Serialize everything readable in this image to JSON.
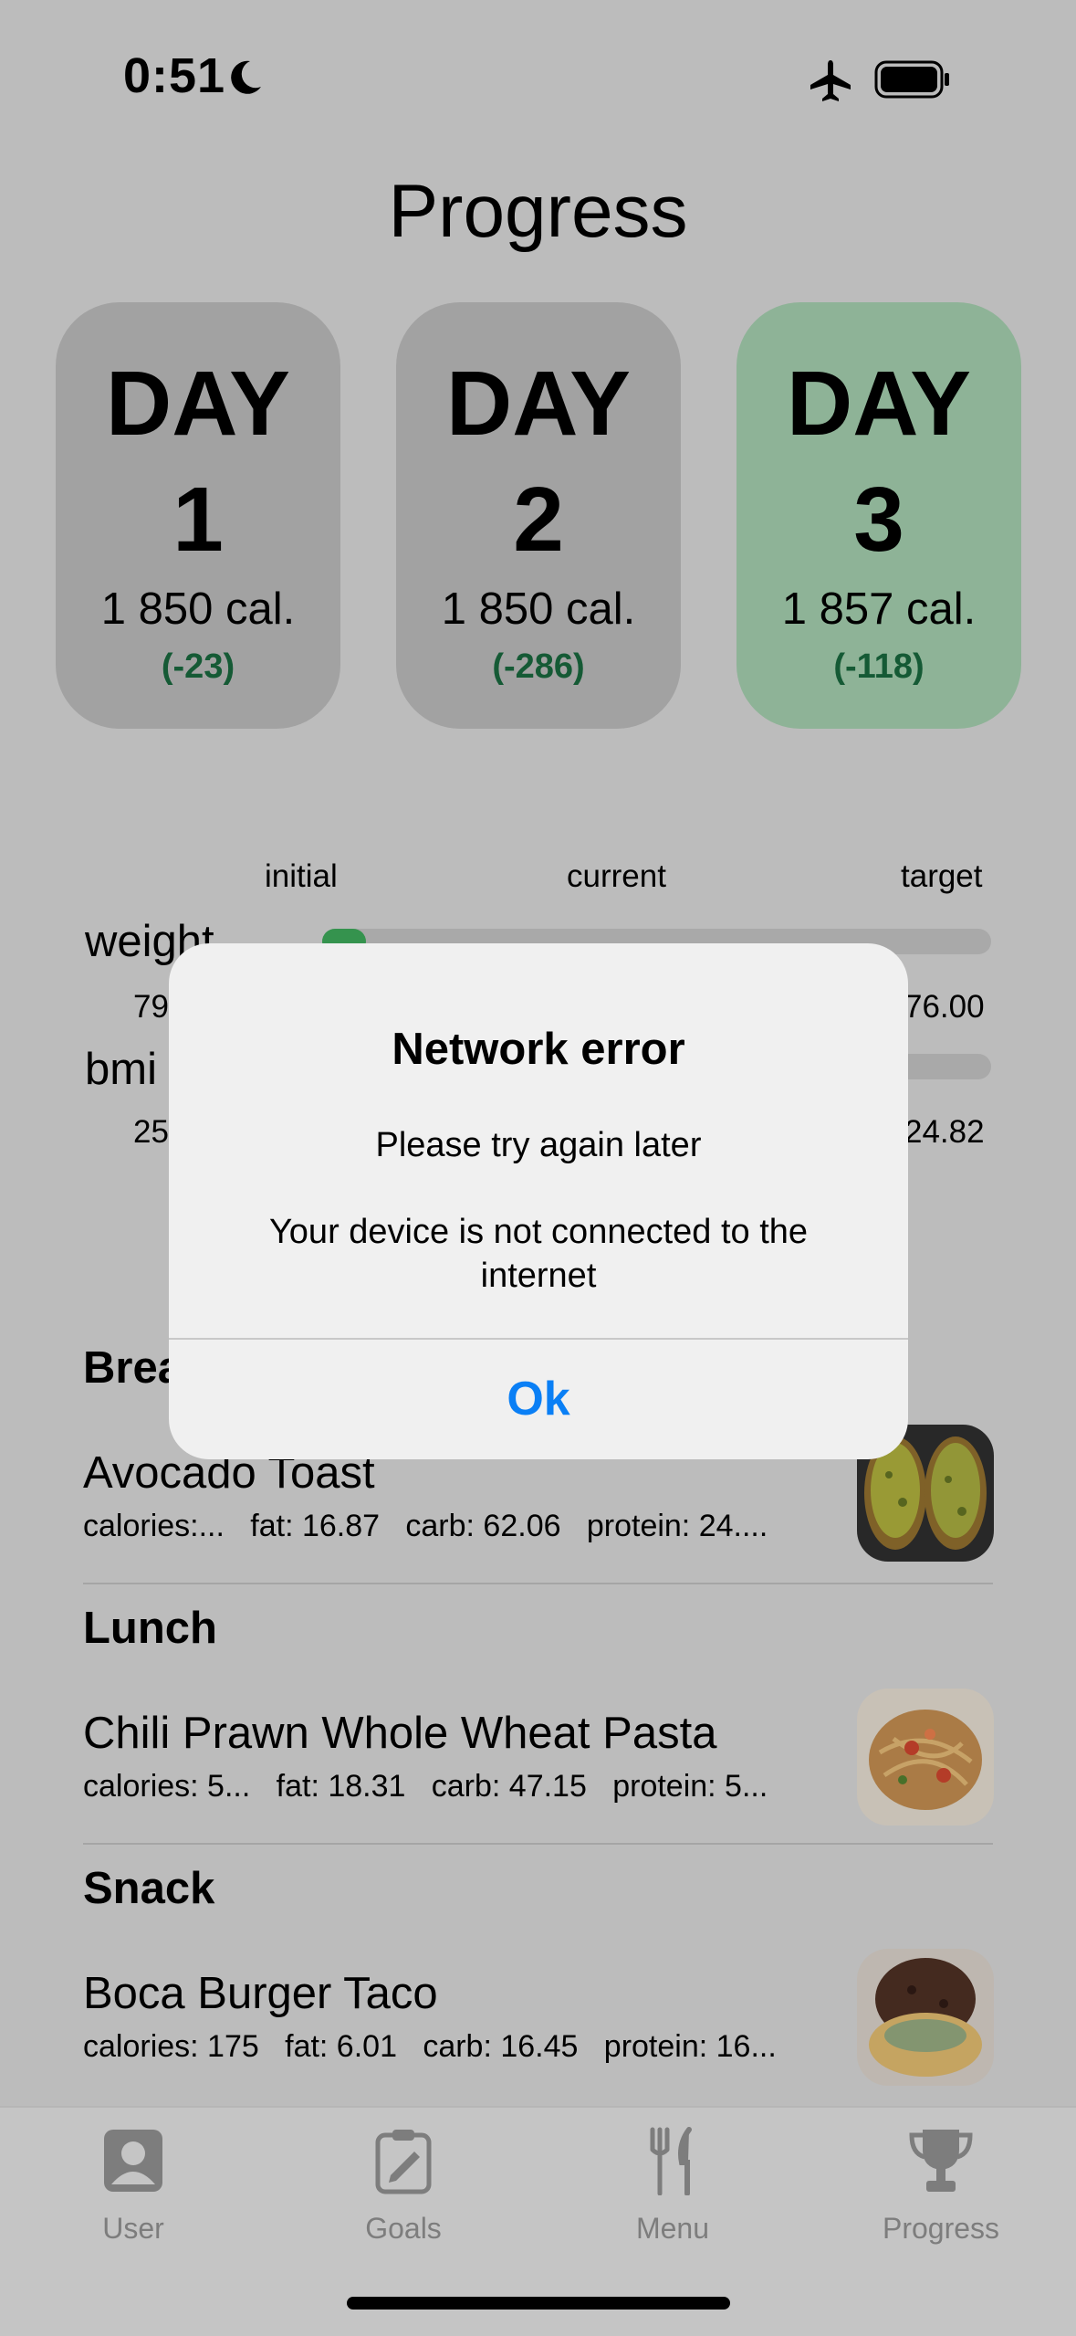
{
  "status_bar": {
    "time": "0:51"
  },
  "header": {
    "title": "Progress"
  },
  "days": [
    {
      "word": "DAY",
      "number": "1",
      "calories": "1 850 cal.",
      "delta": "(-23)",
      "active": false
    },
    {
      "word": "DAY",
      "number": "2",
      "calories": "1 850 cal.",
      "delta": "(-286)",
      "active": false
    },
    {
      "word": "DAY",
      "number": "3",
      "calories": "1 857 cal.",
      "delta": "(-118)",
      "active": true
    }
  ],
  "metrics": {
    "headers": {
      "initial": "initial",
      "current": "current",
      "target": "target"
    },
    "weight": {
      "label": "weight",
      "initial": "79",
      "target": "76.00",
      "progress_fraction": 0.04
    },
    "bmi": {
      "label": "bmi",
      "initial": "25",
      "target": "24.82",
      "progress_fraction": 0.0
    }
  },
  "meals": [
    {
      "title": "Brea",
      "dish": "Avocado Toast",
      "macros": "calories:...   fat: 16.87   carb: 62.06   protein: 24...."
    },
    {
      "title": "Lunch",
      "dish": "Chili Prawn Whole Wheat Pasta",
      "macros": "calories: 5...   fat: 18.31   carb: 47.15   protein: 5..."
    },
    {
      "title": "Snack",
      "dish": "Boca Burger Taco",
      "macros": "calories: 175   fat: 6.01   carb: 16.45   protein: 16..."
    }
  ],
  "alert": {
    "title": "Network error",
    "message": "Please try again later",
    "detail": "Your device is not connected to the internet",
    "ok_label": "Ok"
  },
  "tabs": [
    {
      "label": "User",
      "icon": "user-icon"
    },
    {
      "label": "Goals",
      "icon": "clipboard-icon"
    },
    {
      "label": "Menu",
      "icon": "fork-knife-icon"
    },
    {
      "label": "Progress",
      "icon": "trophy-icon"
    }
  ],
  "colors": {
    "accent": "#0a7ff5",
    "active_day": "#9bc3a4",
    "delta_text": "#17623a",
    "progress_fill": "#3aa055"
  }
}
